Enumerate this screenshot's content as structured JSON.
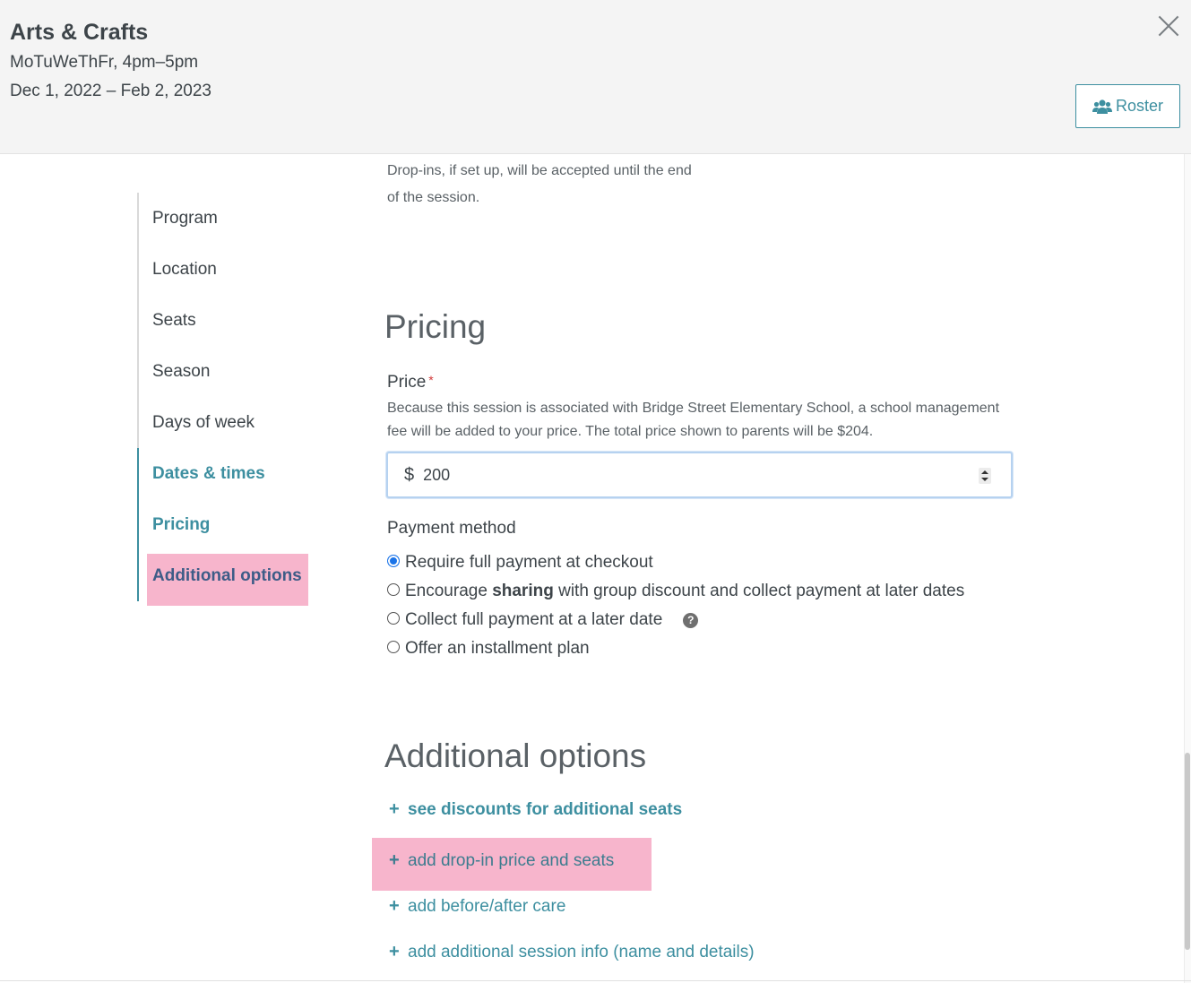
{
  "header": {
    "title": "Arts & Crafts",
    "days": "MoTuWeThFr, 4pm–5pm",
    "dates": "Dec 1, 2022 – Feb 2, 2023",
    "roster_label": "Roster",
    "close_icon": "close-icon",
    "roster_icon": "users-icon"
  },
  "sidebar": {
    "items": [
      {
        "label": "Program"
      },
      {
        "label": "Location"
      },
      {
        "label": "Seats"
      },
      {
        "label": "Season"
      },
      {
        "label": "Days of week"
      },
      {
        "label": "Dates & times"
      },
      {
        "label": "Pricing"
      },
      {
        "label": "Additional options"
      }
    ],
    "highlighted": "Additional options"
  },
  "main": {
    "dropins_note": "Drop-ins, if set up, will be accepted until the end of the session.",
    "pricing": {
      "title": "Pricing",
      "price_label": "Price",
      "required_mark": "*",
      "price_note": "Because this session is associated with Bridge Street Elementary School, a school management fee will be added to your price. The total price shown to parents will be $204.",
      "currency_symbol": "$",
      "price_value": "200",
      "payment_method_label": "Payment method",
      "payment_options": [
        {
          "label": "Require full payment at checkout",
          "selected": true
        },
        {
          "prefix": "Encourage ",
          "bold": "sharing",
          "suffix": " with group discount and collect payment at later dates",
          "selected": false
        },
        {
          "label": "Collect full payment at a later date",
          "selected": false
        },
        {
          "label": "Offer an installment plan",
          "selected": false
        }
      ],
      "help_icon": "?"
    },
    "additional": {
      "title": "Additional options",
      "links": [
        {
          "label": "see discounts for additional seats"
        },
        {
          "label": "add drop-in price and seats"
        },
        {
          "label": "add before/after care"
        },
        {
          "label": "add additional session info (name and details)"
        }
      ],
      "plus": "+"
    }
  },
  "colors": {
    "accent": "#3d8fa0",
    "highlight": "#f7b5cc",
    "header_bg": "#f4f4f4",
    "text": "#3d4449"
  }
}
